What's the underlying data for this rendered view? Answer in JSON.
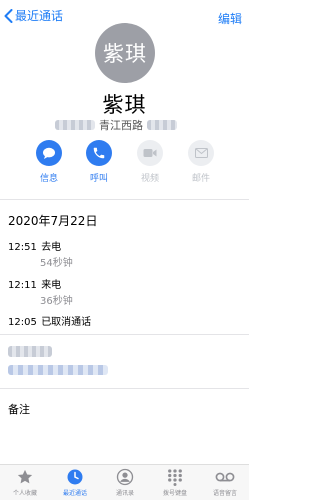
{
  "nav": {
    "back_label": "最近通话",
    "edit_label": "编辑"
  },
  "contact": {
    "avatar_text": "紫琪",
    "name": "紫琪",
    "subtitle": "青江西路"
  },
  "actions": [
    {
      "label": "信息",
      "icon": "message-icon",
      "enabled": true
    },
    {
      "label": "呼叫",
      "icon": "phone-icon",
      "enabled": true
    },
    {
      "label": "视频",
      "icon": "video-icon",
      "enabled": false
    },
    {
      "label": "邮件",
      "icon": "mail-icon",
      "enabled": false
    }
  ],
  "call_log": {
    "date": "2020年7月22日",
    "entries": [
      {
        "time": "12:51",
        "type": "去电",
        "duration": "54秒钟"
      },
      {
        "time": "12:11",
        "type": "来电",
        "duration": "36秒钟"
      },
      {
        "time": "12:05",
        "type": "已取消通话",
        "duration": ""
      }
    ]
  },
  "notes_label": "备注",
  "tabbar": {
    "items": [
      {
        "label": "个人收藏",
        "icon": "star-icon",
        "active": false
      },
      {
        "label": "最近通话",
        "icon": "clock-icon",
        "active": true
      },
      {
        "label": "通讯录",
        "icon": "person-icon",
        "active": false
      },
      {
        "label": "拨号键盘",
        "icon": "keypad-icon",
        "active": false
      },
      {
        "label": "语音留言",
        "icon": "voicemail-icon",
        "active": false
      }
    ]
  },
  "colors": {
    "accent": "#2f7cf0",
    "avatar_bg": "#9d9fa6",
    "disabled": "#bfc3c9"
  }
}
